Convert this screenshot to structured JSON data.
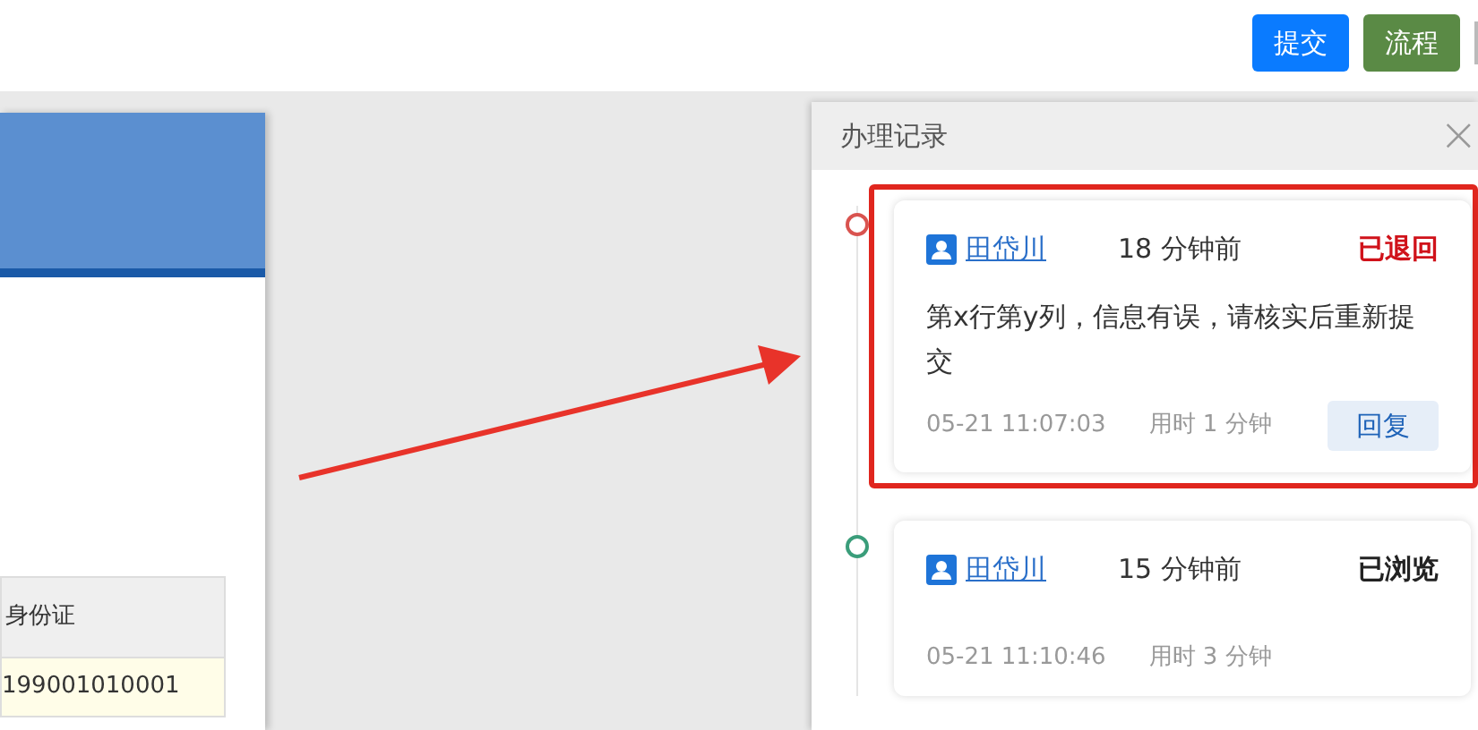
{
  "toolbar": {
    "buttons": [
      {
        "label": "提交",
        "kind": "primary"
      },
      {
        "label": "流程",
        "kind": "flow"
      }
    ]
  },
  "form_table": {
    "columns": [
      "身份证"
    ],
    "rows": [
      [
        "199001010001"
      ]
    ]
  },
  "record_panel": {
    "title": "办理记录",
    "close": "×",
    "records": [
      {
        "user": "田岱川",
        "ago": "18 分钟前",
        "status": "已退回",
        "kind": "returned",
        "color": "#d9534f",
        "highlighted": true,
        "comment": "第x行第y列，信息有误，请核实后重新提交",
        "time": "05-21 11:07:03",
        "duration": "用时 1 分钟",
        "reply": "回复"
      },
      {
        "user": "田岱川",
        "ago": "15 分钟前",
        "status": "已浏览",
        "kind": "viewed",
        "color": "#3a9d7a",
        "highlighted": false,
        "time": "05-21 11:10:46",
        "duration": "用时 3 分钟"
      }
    ]
  }
}
